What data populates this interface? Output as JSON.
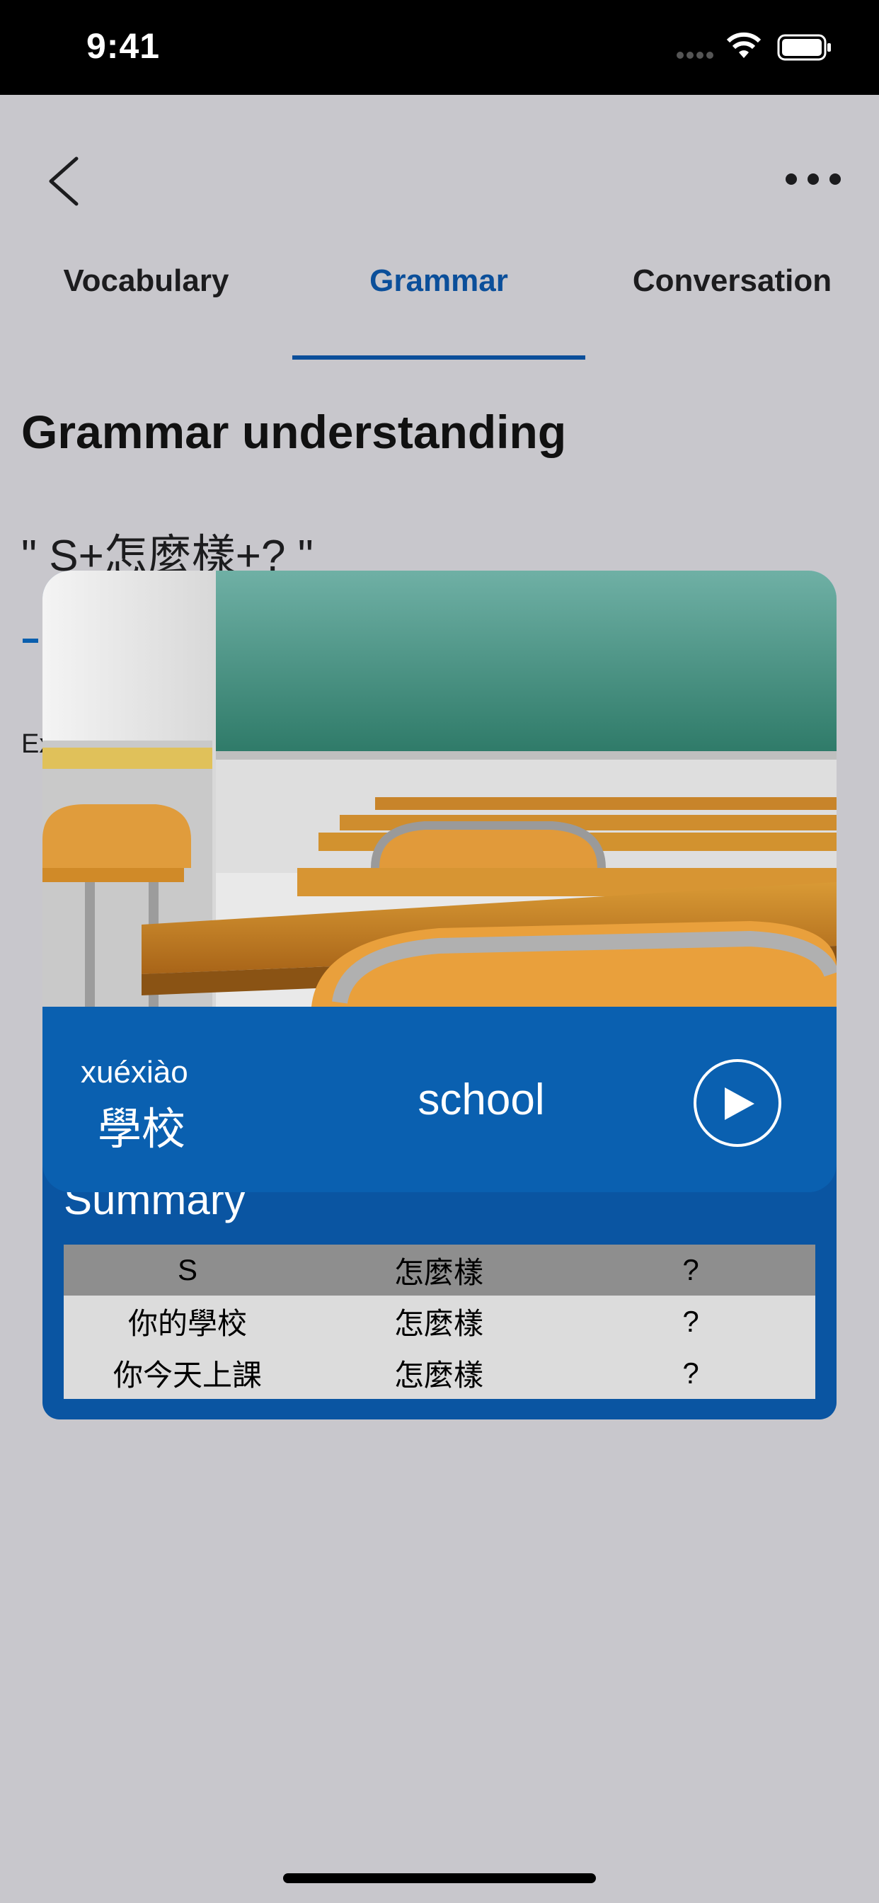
{
  "status_bar": {
    "time": "9:41"
  },
  "tabs": [
    {
      "label": "Vocabulary"
    },
    {
      "label": "Grammar",
      "active": true
    },
    {
      "label": "Conversation"
    }
  ],
  "section": {
    "heading": "Grammar understanding",
    "pattern": "\" S+怎麼樣+?  \"",
    "example_label_fragment": "Ex"
  },
  "word_card": {
    "image": "classroom-photo",
    "pinyin": "xuéxiào",
    "hanzi": "學校",
    "english": "school",
    "play_icon": "play-icon"
  },
  "summary": {
    "title": "Summary",
    "headers": [
      "S",
      "怎麼樣",
      "?"
    ],
    "rows": [
      [
        "你的學校",
        "怎麼樣",
        "?"
      ],
      [
        "你今天上課",
        "怎麼樣",
        "?"
      ]
    ]
  },
  "colors": {
    "accent": "#0b4f9a",
    "card_blue": "#0a60b0",
    "background": "#c8c7cc"
  }
}
